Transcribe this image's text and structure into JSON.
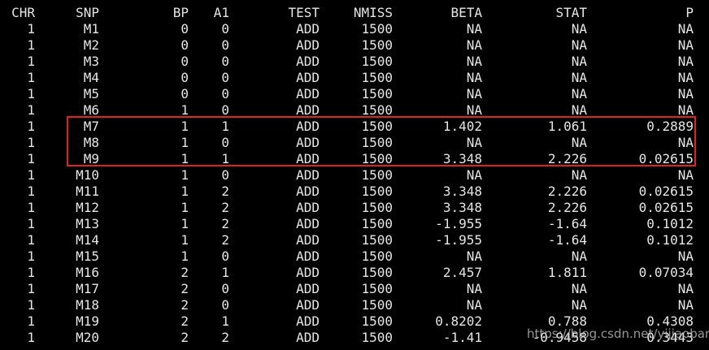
{
  "headers": {
    "chr": "CHR",
    "snp": "SNP",
    "bp": "BP",
    "a1": "A1",
    "test": "TEST",
    "nmiss": "NMISS",
    "beta": "BETA",
    "stat": "STAT",
    "p": "P"
  },
  "rows": [
    {
      "chr": "1",
      "snp": "M1",
      "bp": "0",
      "a1": "0",
      "test": "ADD",
      "nmiss": "1500",
      "beta": "NA",
      "stat": "NA",
      "p": "NA"
    },
    {
      "chr": "1",
      "snp": "M2",
      "bp": "0",
      "a1": "0",
      "test": "ADD",
      "nmiss": "1500",
      "beta": "NA",
      "stat": "NA",
      "p": "NA"
    },
    {
      "chr": "1",
      "snp": "M3",
      "bp": "0",
      "a1": "0",
      "test": "ADD",
      "nmiss": "1500",
      "beta": "NA",
      "stat": "NA",
      "p": "NA"
    },
    {
      "chr": "1",
      "snp": "M4",
      "bp": "0",
      "a1": "0",
      "test": "ADD",
      "nmiss": "1500",
      "beta": "NA",
      "stat": "NA",
      "p": "NA"
    },
    {
      "chr": "1",
      "snp": "M5",
      "bp": "0",
      "a1": "0",
      "test": "ADD",
      "nmiss": "1500",
      "beta": "NA",
      "stat": "NA",
      "p": "NA"
    },
    {
      "chr": "1",
      "snp": "M6",
      "bp": "1",
      "a1": "0",
      "test": "ADD",
      "nmiss": "1500",
      "beta": "NA",
      "stat": "NA",
      "p": "NA"
    },
    {
      "chr": "1",
      "snp": "M7",
      "bp": "1",
      "a1": "1",
      "test": "ADD",
      "nmiss": "1500",
      "beta": "1.402",
      "stat": "1.061",
      "p": "0.2889"
    },
    {
      "chr": "1",
      "snp": "M8",
      "bp": "1",
      "a1": "0",
      "test": "ADD",
      "nmiss": "1500",
      "beta": "NA",
      "stat": "NA",
      "p": "NA"
    },
    {
      "chr": "1",
      "snp": "M9",
      "bp": "1",
      "a1": "1",
      "test": "ADD",
      "nmiss": "1500",
      "beta": "3.348",
      "stat": "2.226",
      "p": "0.02615"
    },
    {
      "chr": "1",
      "snp": "M10",
      "bp": "1",
      "a1": "0",
      "test": "ADD",
      "nmiss": "1500",
      "beta": "NA",
      "stat": "NA",
      "p": "NA"
    },
    {
      "chr": "1",
      "snp": "M11",
      "bp": "1",
      "a1": "2",
      "test": "ADD",
      "nmiss": "1500",
      "beta": "3.348",
      "stat": "2.226",
      "p": "0.02615"
    },
    {
      "chr": "1",
      "snp": "M12",
      "bp": "1",
      "a1": "2",
      "test": "ADD",
      "nmiss": "1500",
      "beta": "3.348",
      "stat": "2.226",
      "p": "0.02615"
    },
    {
      "chr": "1",
      "snp": "M13",
      "bp": "1",
      "a1": "2",
      "test": "ADD",
      "nmiss": "1500",
      "beta": "-1.955",
      "stat": "-1.64",
      "p": "0.1012"
    },
    {
      "chr": "1",
      "snp": "M14",
      "bp": "1",
      "a1": "2",
      "test": "ADD",
      "nmiss": "1500",
      "beta": "-1.955",
      "stat": "-1.64",
      "p": "0.1012"
    },
    {
      "chr": "1",
      "snp": "M15",
      "bp": "1",
      "a1": "0",
      "test": "ADD",
      "nmiss": "1500",
      "beta": "NA",
      "stat": "NA",
      "p": "NA"
    },
    {
      "chr": "1",
      "snp": "M16",
      "bp": "2",
      "a1": "1",
      "test": "ADD",
      "nmiss": "1500",
      "beta": "2.457",
      "stat": "1.811",
      "p": "0.07034"
    },
    {
      "chr": "1",
      "snp": "M17",
      "bp": "2",
      "a1": "0",
      "test": "ADD",
      "nmiss": "1500",
      "beta": "NA",
      "stat": "NA",
      "p": "NA"
    },
    {
      "chr": "1",
      "snp": "M18",
      "bp": "2",
      "a1": "0",
      "test": "ADD",
      "nmiss": "1500",
      "beta": "NA",
      "stat": "NA",
      "p": "NA"
    },
    {
      "chr": "1",
      "snp": "M19",
      "bp": "2",
      "a1": "1",
      "test": "ADD",
      "nmiss": "1500",
      "beta": "0.8202",
      "stat": "0.788",
      "p": "0.4308"
    },
    {
      "chr": "1",
      "snp": "M20",
      "bp": "2",
      "a1": "2",
      "test": "ADD",
      "nmiss": "1500",
      "beta": "-1.41",
      "stat": "-0.9458",
      "p": "0.3443"
    }
  ],
  "highlight_color": "#e0241b",
  "watermark": "https://blog.csdn.net/yijiaobani"
}
